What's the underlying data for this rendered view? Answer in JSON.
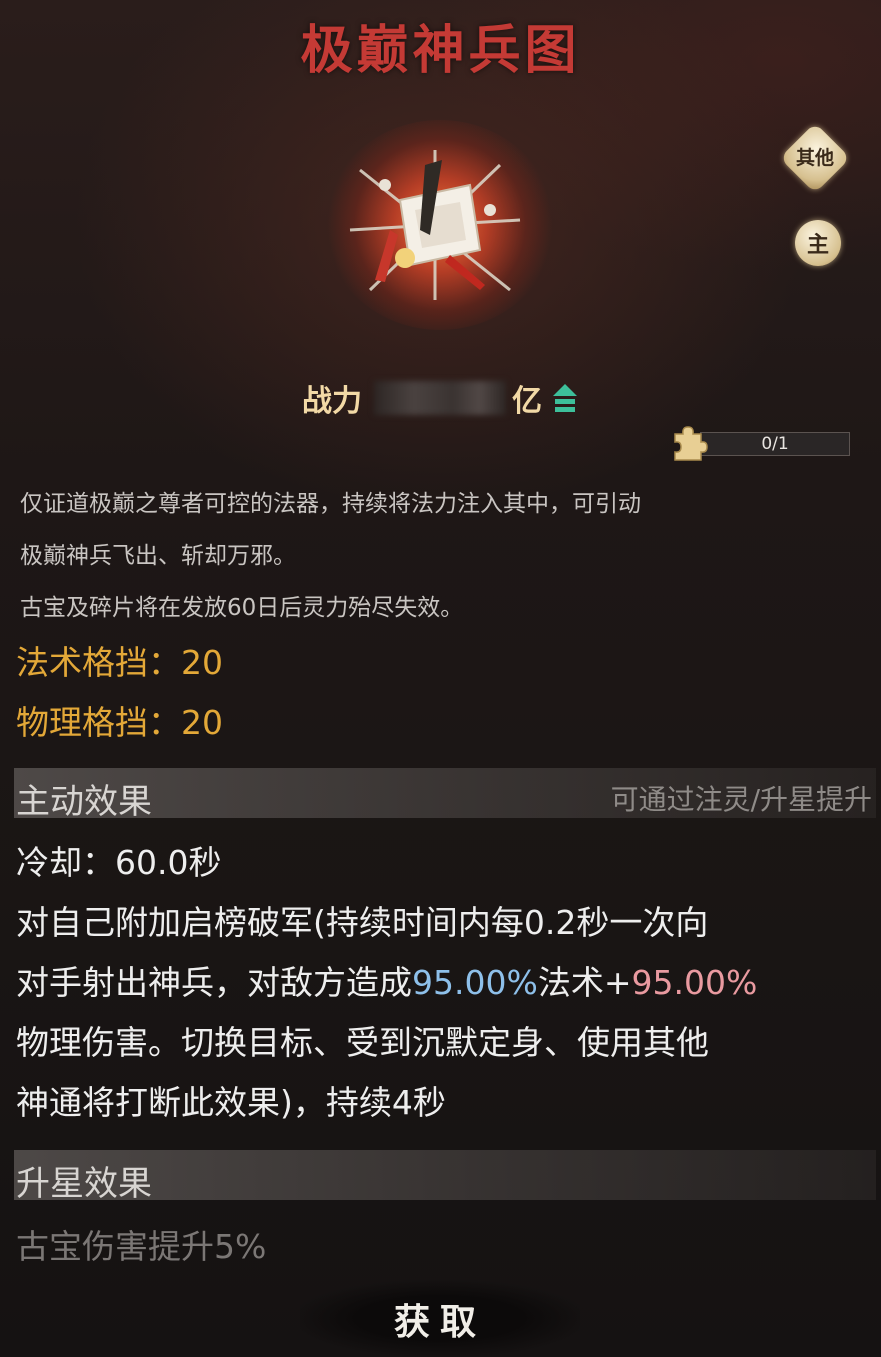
{
  "title": "极巅神兵图",
  "side_buttons": {
    "other": "其他",
    "main": "主"
  },
  "power": {
    "label": "战力",
    "unit": "亿"
  },
  "fragments": {
    "progress": "0/1"
  },
  "description": [
    "仅证道极巅之尊者可控的法器，持续将法力注入其中，可引动",
    "极巅神兵飞出、斩却万邪。",
    "古宝及碎片将在发放60日后灵力殆尽失效。"
  ],
  "stats": [
    "法术格挡：20",
    "物理格挡：20"
  ],
  "active_effect": {
    "header": "主动效果",
    "hint": "可通过注灵/升星提升",
    "cooldown": "冷却：60.0秒",
    "line1": "对自己附加启榜破军(持续时间内每0.2秒一次向",
    "line2_a": "对手射出神兵，对敌方造成",
    "line2_b": "95.00%",
    "line2_c": "法术+",
    "line2_d": "95.00%",
    "line3": "物理伤害。切换目标、受到沉默定身、使用其他",
    "line4": "神通将打断此效果)，持续4秒"
  },
  "star_effect": {
    "header": "升星效果",
    "text": "古宝伤害提升5%"
  },
  "get_button": "获取",
  "colors": {
    "title": "#c43a35",
    "stat": "#e3a838",
    "magic_pct": "#8ec0ea",
    "phys_pct": "#e99aa0",
    "upgrade_arrow": "#3dbf9a"
  },
  "icons": [
    "artifact-image",
    "upgrade-arrow-icon",
    "puzzle-fragment-icon"
  ]
}
